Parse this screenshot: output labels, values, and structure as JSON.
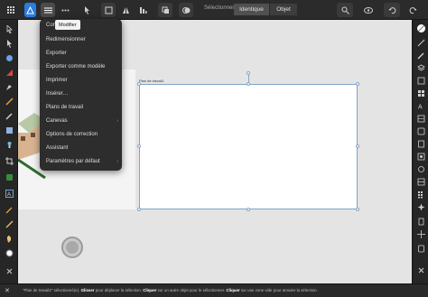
{
  "toolbar": {
    "selection_label": "Sélectionner",
    "selection_options": [
      "Identique",
      "Objet"
    ]
  },
  "menu": {
    "tooltip": "Modifier",
    "items": [
      {
        "label": "Convertir le document",
        "visible_label": "Con           ocument"
      },
      {
        "label": "Redimensionner"
      },
      {
        "label": "Exporter"
      },
      {
        "label": "Exporter comme modèle"
      },
      {
        "label": "Imprimer"
      },
      {
        "label": "Insérer…"
      },
      {
        "label": "Plans de travail"
      },
      {
        "label": "Canevas",
        "submenu": true
      },
      {
        "label": "Options de correction"
      },
      {
        "label": "Assistant"
      },
      {
        "label": "Paramètres par défaut",
        "submenu": true
      }
    ]
  },
  "canvas": {
    "artboard_label": "Plan de travail1"
  },
  "status": {
    "part1": "\"Plan de travail2\" sélectionné(e). ",
    "b1": "Glisser",
    "part2": " pour déplacer la sélection. ",
    "b2": "Cliquer",
    "part3": " sur un autre objet pour le sélectionner. ",
    "b3": "Cliquer",
    "part4": " sur une zone vide pour annuler la sélection."
  },
  "icons": {
    "left": [
      "move-tool-icon",
      "node-tool-icon",
      "artboard-tool-icon",
      "fill-tool-icon",
      "pen-tool-icon",
      "pencil-tool-icon",
      "brush-tool-icon",
      "shape-tool-icon",
      "erase-tool-icon",
      "crop-tool-icon",
      "gradient-tool-icon",
      "text-tool-icon",
      "eyedropper-icon",
      "hand-icon",
      "color-swatch-icon",
      "close-icon"
    ],
    "right": [
      "color-icon",
      "stroke-icon",
      "brushes-icon",
      "layers-icon",
      "effects-icon",
      "styles-icon",
      "text-styles-icon",
      "transform-icon",
      "navigator-icon",
      "history-icon",
      "symbols-icon",
      "constraints-icon",
      "assets-icon",
      "glyphs-icon",
      "snapping-icon"
    ]
  },
  "colors": {
    "accent": "#2a7ce0",
    "selection": "#7fa3c9",
    "toolbar_bg": "#2b2b2b"
  }
}
